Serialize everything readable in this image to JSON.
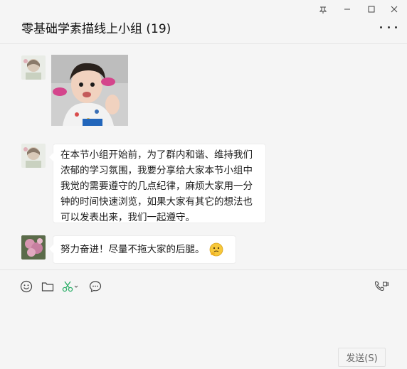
{
  "window": {
    "chat_title": "零基础学素描线上小组 (19)",
    "controls": {
      "pin": "pin-icon",
      "minimize": "minimize-icon",
      "maximize": "maximize-icon",
      "close": "close-icon"
    }
  },
  "messages": [
    {
      "type": "image",
      "sender_avatar": "girl-avatar",
      "image": "sticker-photo-little-girl"
    },
    {
      "type": "text",
      "sender_avatar": "girl-avatar",
      "text": "在本节小组开始前，为了群内和谐、维持我们浓郁的学习氛围，我要分享给大家本节小组中我觉的需要遵守的几点纪律，麻烦大家用一分钟的时间快速浏览，如果大家有其它的想法也可以发表出来，我们一起遵守。"
    },
    {
      "type": "text",
      "sender_avatar": "flower-avatar",
      "text": "努力奋进！尽量不拖大家的后腿。",
      "emoji": "thinking-emoji"
    }
  ],
  "toolbar": {
    "icons": [
      "emoji-icon",
      "folder-icon",
      "scissors-icon",
      "chat-bubble-icon",
      "video-call-icon"
    ]
  },
  "composer": {
    "send_label": "发送(S)"
  },
  "colors": {
    "accent_green": "#2aae67",
    "background": "#f5f5f5",
    "bubble": "#ffffff"
  }
}
